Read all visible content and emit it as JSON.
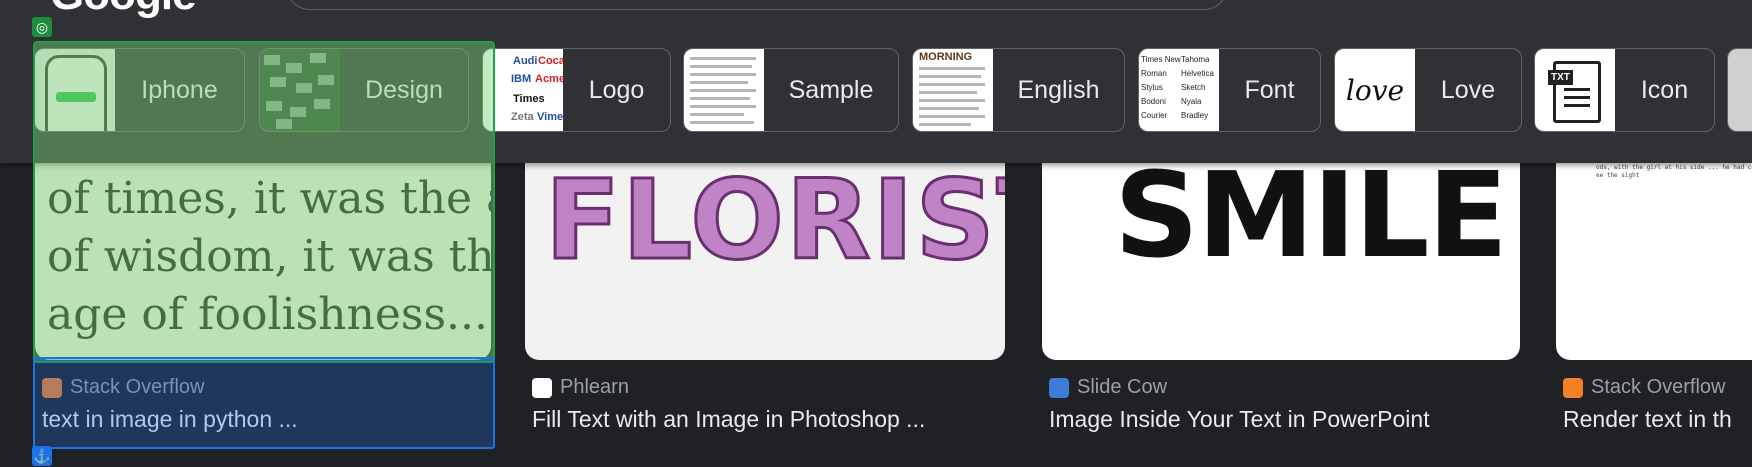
{
  "header": {
    "logo_text": "Google",
    "chips": [
      {
        "label": "Iphone",
        "icon": "iphone-thumbnail"
      },
      {
        "label": "Design",
        "icon": "design-thumbnail"
      },
      {
        "label": "Logo",
        "icon": "logo-thumbnail"
      },
      {
        "label": "Sample",
        "icon": "sample-thumbnail"
      },
      {
        "label": "English",
        "icon": "english-thumbnail"
      },
      {
        "label": "Font",
        "icon": "font-thumbnail"
      },
      {
        "label": "Love",
        "icon": "love-thumbnail"
      },
      {
        "label": "Icon",
        "icon": "icon-thumbnail"
      }
    ]
  },
  "thumb_text": {
    "english_head": "MORNING",
    "love_word": "love",
    "icon_tag": "TXT",
    "font_col1": [
      "Times New",
      "Roman",
      "Stylus",
      "Bodoni",
      "Courier"
    ],
    "font_col2": [
      "Tahoma",
      "Helvetica",
      "Sketch",
      "Nyala",
      "Bradley"
    ]
  },
  "results": [
    {
      "source": "Stack Overflow",
      "title": "text in image in python ...",
      "image_text": [
        "of times, it was the ag",
        "of wisdom, it was the",
        "age of foolishness..."
      ]
    },
    {
      "source": "Phlearn",
      "title": "Fill Text with an Image in Photoshop ...",
      "image_text": "FLORIST"
    },
    {
      "source": "Slide Cow",
      "title": "Image Inside Your Text in PowerPoint",
      "image_text": "SMILE"
    },
    {
      "source": "Stack Overflow",
      "title": "Render text in th"
    }
  ],
  "colors": {
    "background": "#202124",
    "header": "#303134",
    "selection_green": "#1aa34a",
    "selection_blue": "#1a73e8"
  }
}
